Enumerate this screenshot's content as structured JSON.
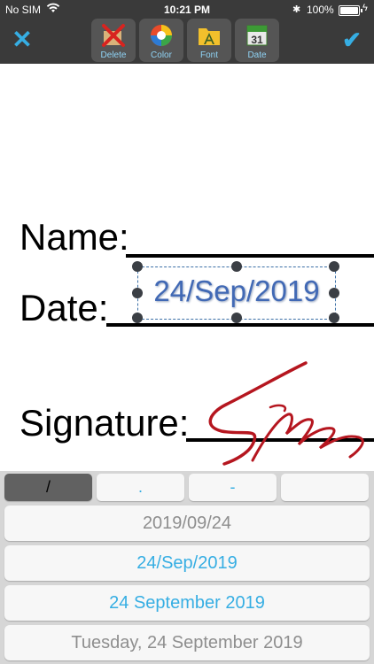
{
  "status": {
    "carrier": "No SIM",
    "time": "10:21 PM",
    "battery": "100%"
  },
  "toolbar": {
    "tools": [
      {
        "label": "Delete",
        "icon": "delete-x-icon"
      },
      {
        "label": "Color",
        "icon": "color-wheel-icon"
      },
      {
        "label": "Font",
        "icon": "font-folder-icon"
      },
      {
        "label": "Date",
        "icon": "calendar-icon",
        "calendar_day": "31"
      }
    ],
    "accent": "#36aee3"
  },
  "document": {
    "name_label": "Name:",
    "date_label": "Date:",
    "signature_label": "Signature:",
    "date_value": "24/Sep/2019",
    "signature_color": "#b5161f"
  },
  "separators": [
    "/",
    ".",
    "-",
    ""
  ],
  "selected_separator": "/",
  "formats": [
    {
      "text": "2019/09/24",
      "color": "#8e8e8e"
    },
    {
      "text": "24/Sep/2019",
      "color": "#36aee3"
    },
    {
      "text": "24 September 2019",
      "color": "#36aee3"
    },
    {
      "text": "Tuesday, 24 September 2019",
      "color": "#8e8e8e"
    }
  ]
}
